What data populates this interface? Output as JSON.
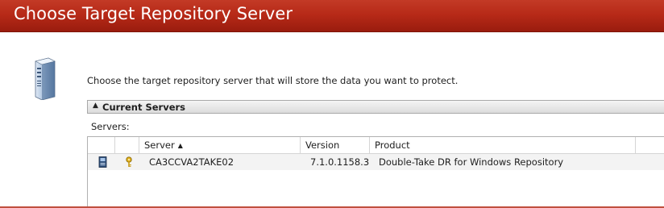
{
  "window": {
    "title": "Choose Target Repository Server"
  },
  "content": {
    "instruction": "Choose the target repository server that will store the data you want to protect.",
    "group_title": "Current Servers",
    "group_caret": "▲",
    "servers_label": "Servers:"
  },
  "table": {
    "columns": [
      {
        "label": "",
        "key": "icon"
      },
      {
        "label": "",
        "key": "status"
      },
      {
        "label": "Server",
        "key": "server",
        "sorted": "ascending",
        "sort_glyph": "▲"
      },
      {
        "label": "Version",
        "key": "version"
      },
      {
        "label": "Product",
        "key": "product"
      },
      {
        "label": "",
        "key": "extra"
      }
    ],
    "rows": [
      {
        "icon": "server-machine-icon",
        "status_icon": "key-icon",
        "server": "CA3CCVA2TAKE02",
        "version": "7.1.0.1158.3",
        "product": "Double-Take DR for Windows Repository"
      }
    ]
  },
  "colors": {
    "titlebar": "#b72a18",
    "title_text": "#ffffff",
    "row_background": "#f3f3f3"
  }
}
